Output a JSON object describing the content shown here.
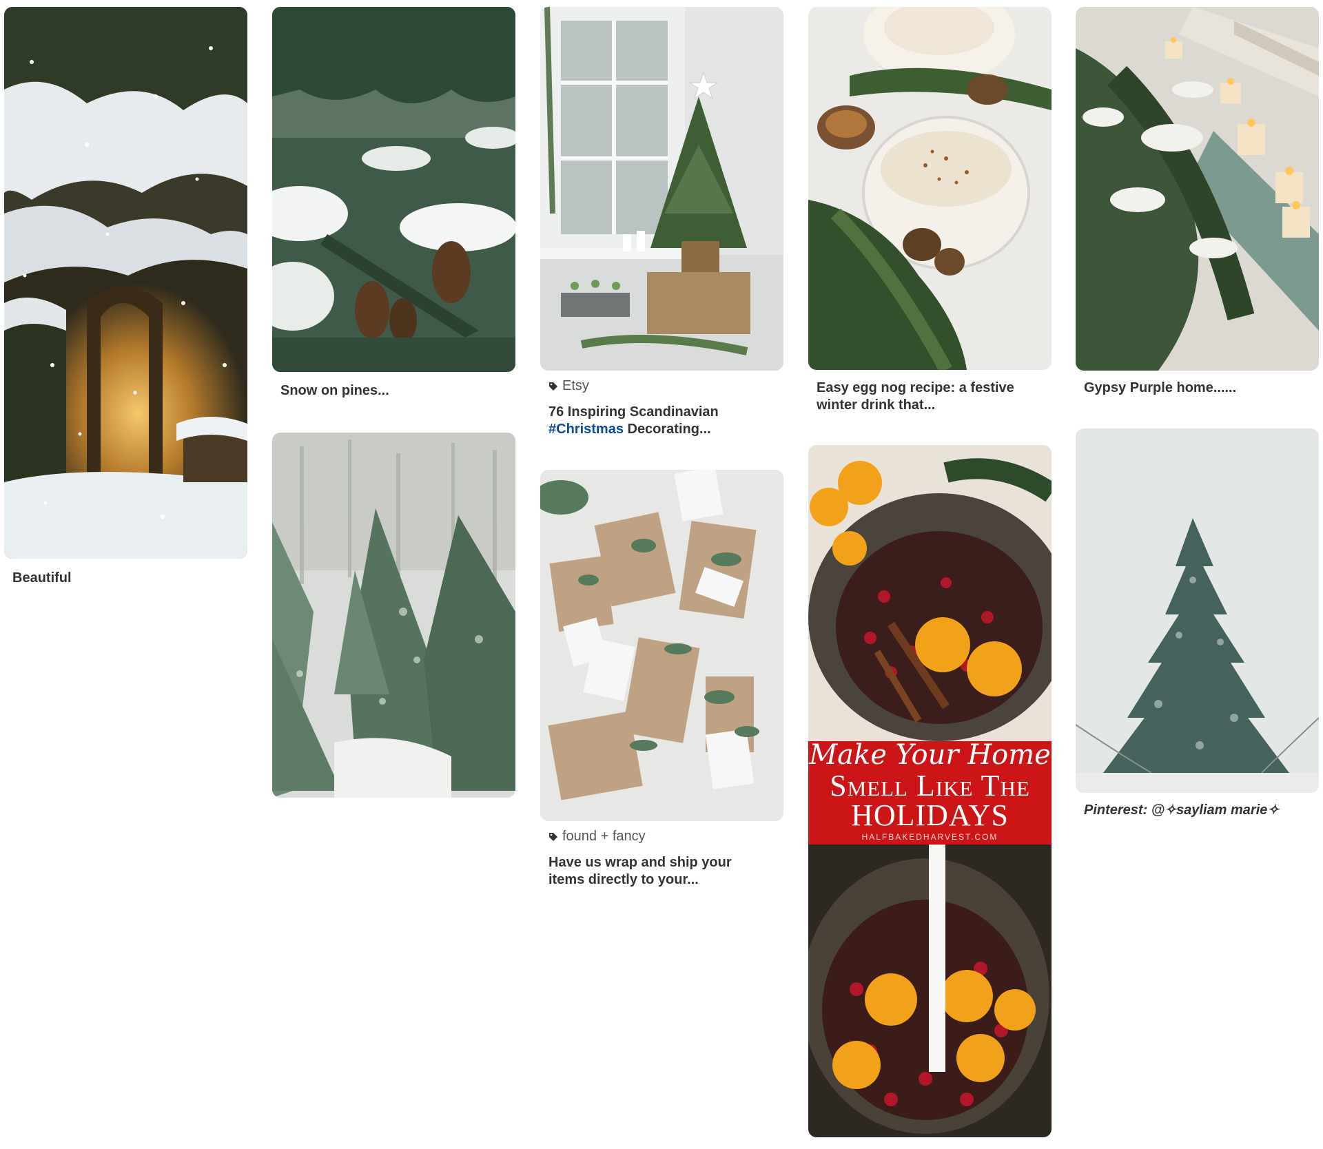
{
  "pins": [
    {
      "id": "beautiful",
      "title": "Beautiful",
      "image_alt": "snowy garden arch with warm lights"
    },
    {
      "id": "snow-pines",
      "title": "Snow on pines...",
      "image_alt": "snow covered pine branches with cones"
    },
    {
      "id": "tree-farm",
      "title": "",
      "image_alt": "frosted rows of evergreen trees"
    },
    {
      "id": "scandinavian",
      "source": "Etsy",
      "title_part1": "76 Inspiring Scandinavian",
      "hashtag": "#Christmas",
      "title_part2": " Decorating...",
      "image_alt": "small potted christmas tree by a window"
    },
    {
      "id": "wrap-ship",
      "source": "found + fancy",
      "title": "Have us wrap and ship your items directly to your...",
      "image_alt": "kraft paper wrapped gifts with greenery"
    },
    {
      "id": "egg-nog",
      "title": "Easy egg nog recipe: a festive winter drink that...",
      "image_alt": "mugs of egg nog with cinnamon"
    },
    {
      "id": "simmer-pot",
      "title": "",
      "image_alt": "simmer pot with oranges, cranberries and cinnamon",
      "banner": {
        "script": "Make Your Home",
        "main_line1": "Smell Like The",
        "main_line2": "HOLIDAYS",
        "site": "HALFBAKEDHARVEST.COM"
      }
    },
    {
      "id": "gypsy-purple",
      "title": "Gypsy Purple home......",
      "image_alt": "cedar garland with candles in snow"
    },
    {
      "id": "single-tree",
      "title": "Pinterest: @✧sayliam marie✧",
      "image_alt": "lone snowy spruce tree"
    }
  ],
  "colors": {
    "hashtag": "#0a4b9a",
    "banner_red": "#cc1517",
    "text": "#333333"
  },
  "icons": {
    "source_tag": "tag-icon"
  }
}
